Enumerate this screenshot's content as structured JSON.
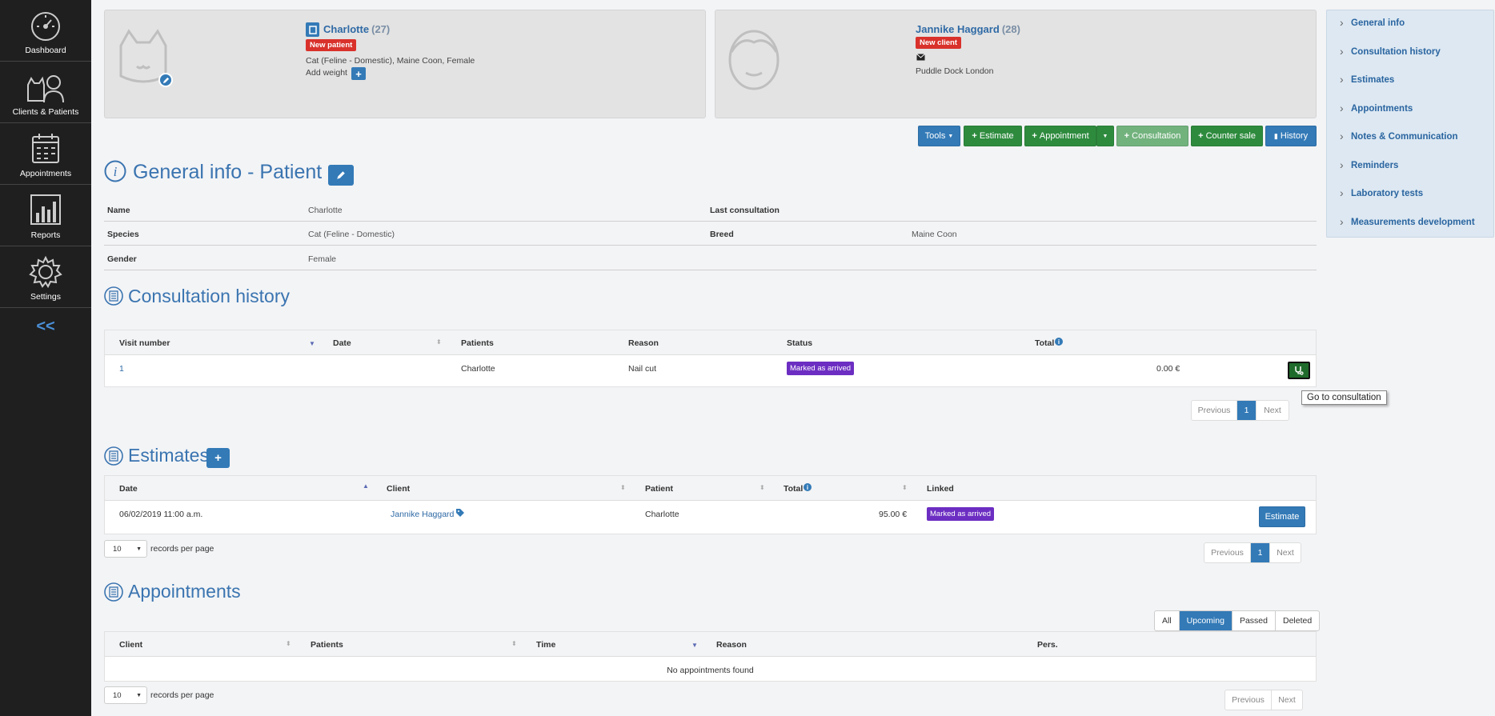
{
  "sidebar": {
    "items": [
      {
        "label": "Dashboard",
        "icon": "dashboard-gauge-icon"
      },
      {
        "label": "Clients & Patients",
        "icon": "clients-patients-icon"
      },
      {
        "label": "Appointments",
        "icon": "calendar-icon"
      },
      {
        "label": "Reports",
        "icon": "bar-chart-icon"
      },
      {
        "label": "Settings",
        "icon": "gear-icon"
      }
    ],
    "collapse": "<<"
  },
  "patient_card": {
    "name": "Charlotte",
    "age": "(27)",
    "badge": "New patient",
    "description": "Cat (Feline - Domestic), Maine Coon, Female",
    "add_weight": "Add weight"
  },
  "client_card": {
    "name": "Jannike Haggard",
    "age": "(28)",
    "badge": "New client",
    "address": "Puddle Dock London"
  },
  "toolbar": {
    "tools": "Tools",
    "estimate": "Estimate",
    "appointment": "Appointment",
    "consultation": "Consultation",
    "counter_sale": "Counter sale",
    "history": "History"
  },
  "general_info": {
    "title": "General info - Patient",
    "name_label": "Name",
    "name_value": "Charlotte",
    "last_consultation_label": "Last consultation",
    "species_label": "Species",
    "species_value": "Cat (Feline - Domestic)",
    "breed_label": "Breed",
    "breed_value": "Maine Coon",
    "gender_label": "Gender",
    "gender_value": "Female"
  },
  "consultation_history": {
    "title": "Consultation history",
    "headers": [
      "Visit number",
      "Date",
      "Patients",
      "Reason",
      "Status",
      "Total"
    ],
    "rows": [
      {
        "visit": "1",
        "date": "",
        "patient": "Charlotte",
        "reason": "Nail cut",
        "status": "Marked as arrived",
        "total": "0.00 €"
      }
    ],
    "tooltip": "Go to consultation",
    "pager": {
      "prev": "Previous",
      "page": "1",
      "next": "Next"
    }
  },
  "estimates": {
    "title": "Estimates",
    "headers": [
      "Date",
      "Client",
      "Patient",
      "Total",
      "Linked"
    ],
    "rows": [
      {
        "date": "06/02/2019 11:00 a.m.",
        "client": "Jannike Haggard",
        "patient": "Charlotte",
        "total": "95.00 €",
        "linked": "Marked as arrived",
        "action": "Estimate"
      }
    ],
    "records_per_page": "10",
    "records_label": "records per page",
    "pager": {
      "prev": "Previous",
      "page": "1",
      "next": "Next"
    }
  },
  "appointments": {
    "title": "Appointments",
    "filters": [
      "All",
      "Upcoming",
      "Passed",
      "Deleted"
    ],
    "active_filter": "Upcoming",
    "headers": [
      "Client",
      "Patients",
      "Time",
      "Reason",
      "Pers."
    ],
    "empty": "No appointments found",
    "records_per_page": "10",
    "records_label": "records per page",
    "pager": {
      "prev": "Previous",
      "next": "Next"
    }
  },
  "right_nav": {
    "items": [
      "General info",
      "Consultation history",
      "Estimates",
      "Appointments",
      "Notes & Communication",
      "Reminders",
      "Laboratory tests",
      "Measurements development"
    ]
  },
  "colors": {
    "sidebar_bg": "#1f1f1f",
    "primary": "#337ab7",
    "success": "#2e8b3e",
    "danger": "#d9312b",
    "status_purple": "#6c2ec2"
  }
}
